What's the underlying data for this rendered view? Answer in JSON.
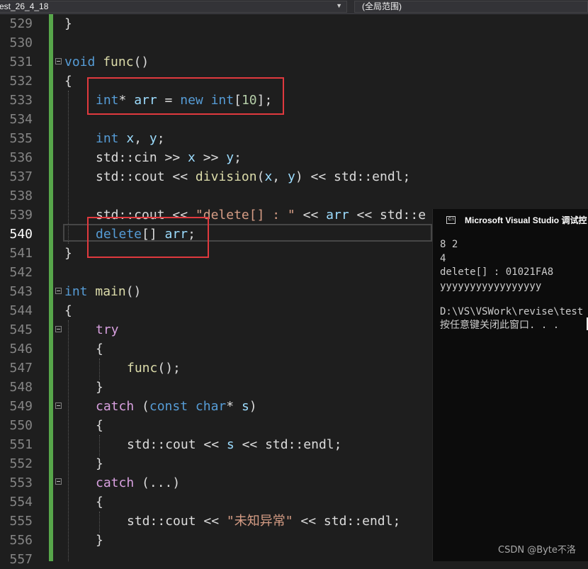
{
  "nav": {
    "file_scope": "est_26_4_18",
    "member_scope": "(全局范围)"
  },
  "editor": {
    "line_numbers": [
      "529",
      "530",
      "531",
      "532",
      "533",
      "534",
      "535",
      "536",
      "537",
      "538",
      "539",
      "540",
      "541",
      "542",
      "543",
      "544",
      "545",
      "546",
      "547",
      "548",
      "549",
      "550",
      "551",
      "552",
      "553",
      "554",
      "555",
      "556",
      "557"
    ],
    "active_line": "540",
    "code": {
      "l529": "}",
      "l531": {
        "t1": "void",
        "t2": "func",
        "t3": "()"
      },
      "l532": "{",
      "l533": {
        "t1": "int",
        "t2": "* ",
        "t3": "arr",
        "t4": " = ",
        "t5": "new",
        "t6": " ",
        "t7": "int",
        "t8": "[",
        "t9": "10",
        "t10": "];"
      },
      "l535": {
        "t1": "int",
        "t2": " ",
        "t3": "x",
        "t4": ", ",
        "t5": "y",
        "t6": ";"
      },
      "l536": {
        "t1": "std::cin >> ",
        "t2": "x",
        "t3": " >> ",
        "t4": "y",
        "t5": ";"
      },
      "l537": {
        "t1": "std::cout << ",
        "t2": "division",
        "t3": "(",
        "t4": "x",
        "t5": ", ",
        "t6": "y",
        "t7": ") << std::endl;"
      },
      "l539": {
        "t1": "std::cout << ",
        "t2": "\"delete[] : \"",
        "t3": " << ",
        "t4": "arr",
        "t5": " << std::e"
      },
      "l540": {
        "t1": "delete",
        "t2": "[] ",
        "t3": "arr",
        "t4": ";"
      },
      "l541": "}",
      "l543": {
        "t1": "int",
        "t2": " ",
        "t3": "main",
        "t4": "()"
      },
      "l544": "{",
      "l545": "try",
      "l546": "{",
      "l547": {
        "t1": "func",
        "t2": "();"
      },
      "l548": "}",
      "l549": {
        "t1": "catch",
        "t2": " (",
        "t3": "const",
        "t4": " ",
        "t5": "char",
        "t6": "* ",
        "t7": "s",
        "t8": ")"
      },
      "l550": "{",
      "l551": {
        "t1": "std::cout << ",
        "t2": "s",
        "t3": " << std::endl;"
      },
      "l552": "}",
      "l553": {
        "t1": "catch",
        "t2": " (...)"
      },
      "l554": "{",
      "l555": {
        "t1": "std::cout << ",
        "t2": "\"未知异常\"",
        "t3": " << std::endl;"
      },
      "l556": "}"
    }
  },
  "console": {
    "title": "Microsoft Visual Studio 调试控",
    "icon": "console-app-icon",
    "lines": [
      "8 2",
      "4",
      "delete[] : 01021FA8",
      "yyyyyyyyyyyyyyyyy",
      "",
      "D:\\VS\\VSWork\\revise\\test",
      "按任意键关闭此窗口. . ."
    ]
  },
  "watermark": "CSDN @Byte不洛",
  "colors": {
    "background": "#1e1e1e",
    "keyword": "#569cd6",
    "control_keyword": "#d8a0df",
    "function": "#dcdcaa",
    "identifier": "#9cdcfe",
    "number": "#b5cea8",
    "string": "#d69d85",
    "change_bar": "#57a64a",
    "highlight_box": "#e0393e",
    "console_bg": "#0c0c0c"
  }
}
